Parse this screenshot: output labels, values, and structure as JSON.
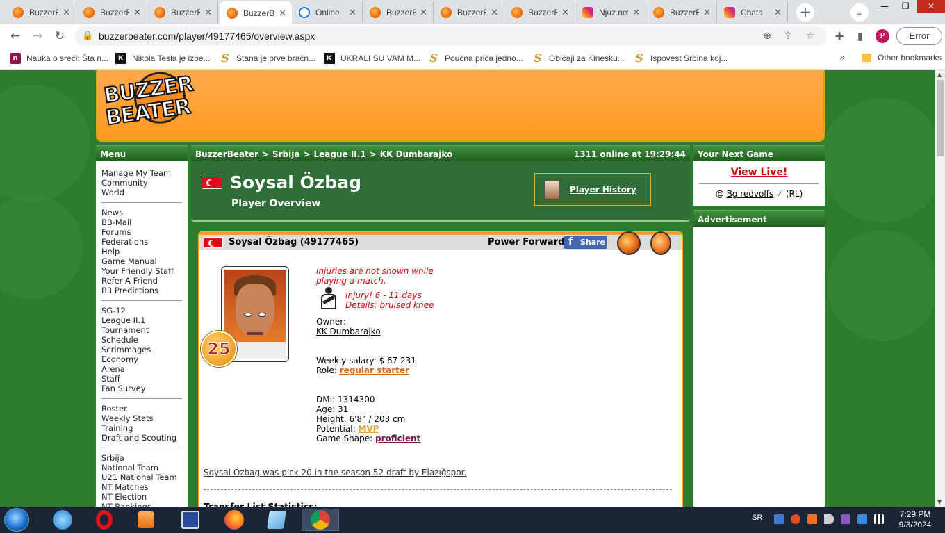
{
  "browser": {
    "tabs": [
      {
        "title": "BuzzerBeater",
        "icon": "bb",
        "active": false
      },
      {
        "title": "BuzzerBeater",
        "icon": "bb",
        "active": false
      },
      {
        "title": "BuzzerBeater",
        "icon": "bb",
        "active": false
      },
      {
        "title": "BuzzerBeater",
        "icon": "bb",
        "active": true
      },
      {
        "title": "Online",
        "icon": "online",
        "active": false
      },
      {
        "title": "BuzzerBeater",
        "icon": "bb",
        "active": false
      },
      {
        "title": "BuzzerBeater",
        "icon": "bb",
        "active": false
      },
      {
        "title": "BuzzerBeater",
        "icon": "bb",
        "active": false
      },
      {
        "title": "Njuz.net",
        "icon": "instagram",
        "active": false
      },
      {
        "title": "BuzzerBeater",
        "icon": "bb",
        "active": false
      },
      {
        "title": "Chats",
        "icon": "instagram",
        "active": false
      }
    ],
    "url": "buzzerbeater.com/player/49177465/overview.aspx",
    "profile_initial": "P",
    "error_label": "Error",
    "bookmarks": [
      {
        "label": "Nauka o sreći: Šta n...",
        "icon": "n"
      },
      {
        "label": "Nikola Tesla je izbe...",
        "icon": "k"
      },
      {
        "label": "Stana je prve bračn...",
        "icon": "s"
      },
      {
        "label": "UKRALI SU VAM M...",
        "icon": "k"
      },
      {
        "label": "Poučna priča jedno...",
        "icon": "s"
      },
      {
        "label": "Običaji za Kinesku...",
        "icon": "s"
      },
      {
        "label": "Ispovest Srbina koj...",
        "icon": "s"
      }
    ],
    "other_bookmarks": "Other bookmarks"
  },
  "logo": {
    "line1": "BUZZER",
    "line2": "BEATER"
  },
  "menu": {
    "title": "Menu",
    "groups": [
      [
        "Manage My Team",
        "Community",
        "World"
      ],
      [
        "News",
        "BB-Mail",
        "Forums",
        "Federations",
        "Help",
        "Game Manual",
        "Your Friendly Staff",
        "Refer A Friend",
        "B3 Predictions"
      ],
      [
        "SG-12",
        "League II.1",
        "Tournament",
        "Schedule",
        "Scrimmages",
        "Economy",
        "Arena",
        "Staff",
        "Fan Survey"
      ],
      [
        "Roster",
        "Weekly Stats",
        "Training",
        "Draft and Scouting"
      ],
      [
        "Srbija",
        "National Team",
        "U21 National Team",
        "NT Matches",
        "NT Election",
        "NT Rankings"
      ]
    ]
  },
  "breadcrumb": {
    "items": [
      "BuzzerBeater",
      "Srbija",
      "League II.1",
      "KK Dumbarajko"
    ],
    "separator": ">",
    "online": "1311 online at 19:29:44"
  },
  "title": {
    "name": "Soysal Özbag",
    "subtitle": "Player Overview",
    "history_link": "Player History"
  },
  "player": {
    "header_name": "Soysal Özbag (49177465)",
    "position": "Power Forward",
    "share_label": "Share",
    "age_badge": "25",
    "injury_note": "Injuries are not shown while playing a match.",
    "injury_line1": "Injury! 6 - 11 days",
    "injury_line2": "Details: bruised knee",
    "owner_label": "Owner:",
    "owner": "KK Dumbarajko",
    "salary_label": "Weekly salary:",
    "salary": "$ 67 231",
    "role_label": "Role:",
    "role": "regular starter",
    "dmi_label": "DMI:",
    "dmi": "1314300",
    "age_label": "Age:",
    "age": "31",
    "height_label": "Height:",
    "height": "6'8\" / 203 cm",
    "potential_label": "Potential:",
    "potential": "MVP",
    "shape_label": "Game Shape:",
    "shape": "proficient",
    "draft_text": "Soysal Özbag was pick 20 in the season 52 draft by Elazığspor.",
    "transfer_title": "Transfer List Statistics:"
  },
  "right": {
    "next_game_title": "Your Next Game",
    "view_live": "View Live!",
    "at": "@",
    "opponent": "Bg redvolfs",
    "check": "✓",
    "league_tag": "(RL)",
    "ad_title": "Advertisement"
  },
  "taskbar": {
    "lang": "SR",
    "time": "7:29 PM",
    "date": "9/3/2024"
  },
  "colors": {
    "orange": "#ff9a1f",
    "green": "#2e7a2e",
    "injury_red": "#cc1111"
  }
}
